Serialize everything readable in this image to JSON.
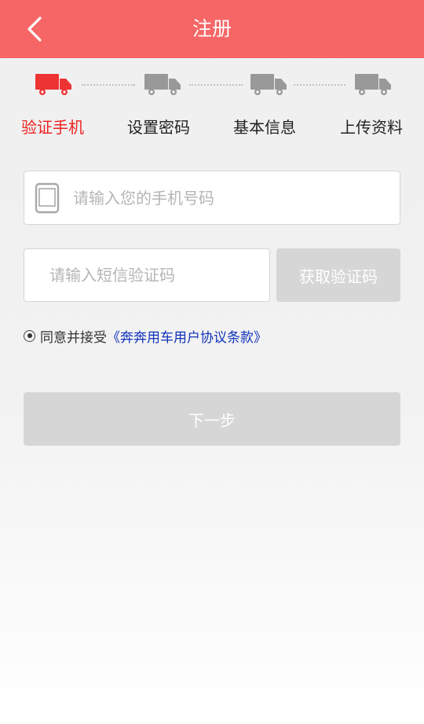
{
  "header": {
    "title": "注册",
    "back_icon": "chevron-left-icon"
  },
  "steps": [
    {
      "label": "验证手机",
      "active": true
    },
    {
      "label": "设置密码",
      "active": false
    },
    {
      "label": "基本信息",
      "active": false
    },
    {
      "label": "上传资料",
      "active": false
    }
  ],
  "colors": {
    "active": "#ee2222",
    "inactive": "#999999",
    "header": "#f66666",
    "link": "#1133bb"
  },
  "form": {
    "phone_placeholder": "请输入您的手机号码",
    "code_placeholder": "请输入短信验证码",
    "get_code_label": "获取验证码",
    "agree_text": "同意并接受",
    "agreement_link": "《奔奔用车用户协议条款》",
    "next_label": "下一步"
  }
}
